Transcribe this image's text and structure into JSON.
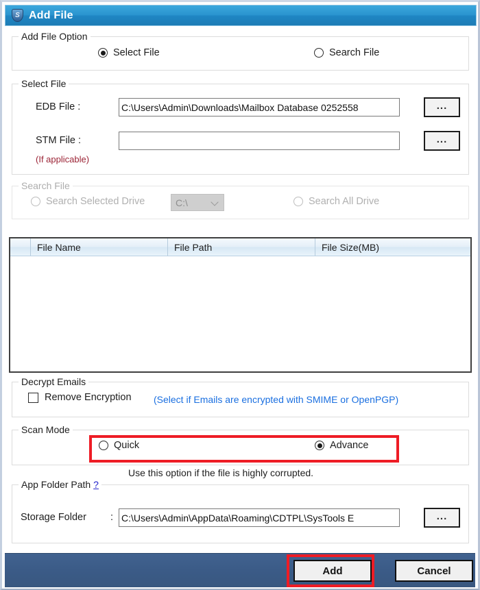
{
  "window": {
    "title": "Add File",
    "icon": "shield-icon",
    "icon_letter": "S"
  },
  "add_file_option": {
    "group_title": "Add File Option",
    "options": [
      {
        "label": "Select File",
        "selected": true
      },
      {
        "label": "Search File",
        "selected": false
      }
    ]
  },
  "select_file": {
    "group_title": "Select File",
    "edb_label": "EDB File :",
    "edb_value": "C:\\Users\\Admin\\Downloads\\Mailbox Database 0252558",
    "edb_browse": "...",
    "stm_label": "STM File :",
    "stm_value": "",
    "stm_note": "(If applicable)",
    "stm_browse": "..."
  },
  "search_file": {
    "group_title": "Search File",
    "disabled": true,
    "selected_drive_label": "Search Selected Drive",
    "drive_value": "C:\\",
    "all_drive_label": "Search All Drive"
  },
  "file_list": {
    "columns": [
      "File Name",
      "File Path",
      "File Size(MB)"
    ],
    "rows": []
  },
  "decrypt_emails": {
    "group_title": "Decrypt Emails",
    "checkbox_label": "Remove Encryption",
    "checked": false,
    "hint": "(Select if Emails are encrypted with SMIME or OpenPGP)",
    "hint_color": "#1a6fe0"
  },
  "scan_mode": {
    "group_title": "Scan Mode",
    "options": [
      {
        "label": "Quick",
        "selected": false
      },
      {
        "label": "Advance",
        "selected": true
      }
    ],
    "hint": "Use this option if the file is highly corrupted.",
    "highlight_color": "#ee1c25"
  },
  "app_folder_path": {
    "group_title": "App Folder Path",
    "help": "?",
    "storage_label": "Storage Folder",
    "storage_colon": ":",
    "storage_value": "C:\\Users\\Admin\\AppData\\Roaming\\CDTPL\\SysTools E",
    "storage_browse": "..."
  },
  "footer": {
    "add_label": "Add",
    "cancel_label": "Cancel",
    "highlight_color": "#ee1c25",
    "background": "#3b5b87"
  }
}
